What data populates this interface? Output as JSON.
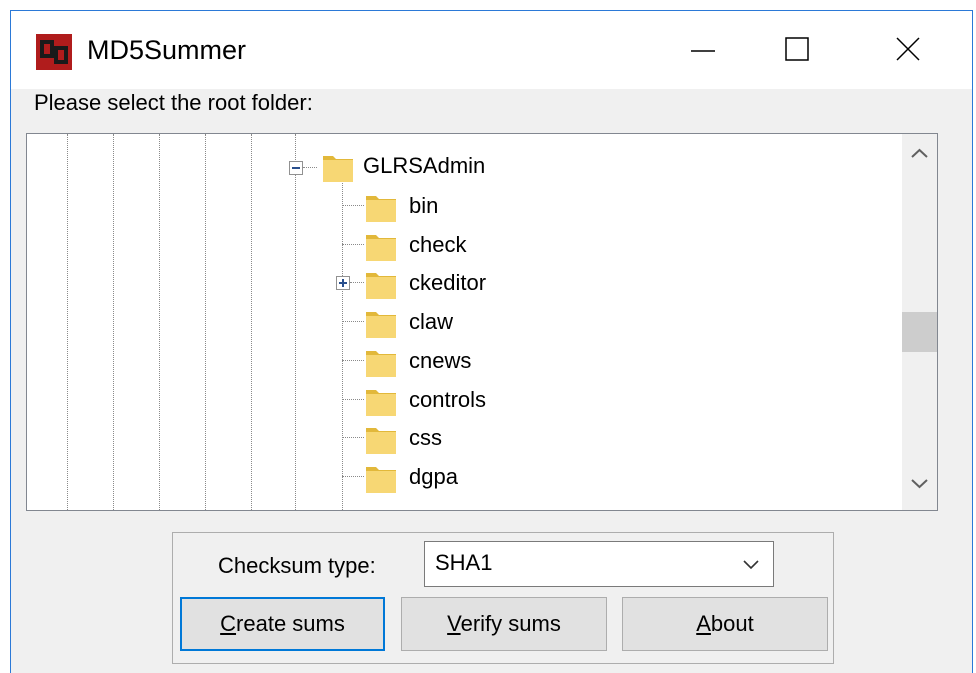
{
  "window": {
    "title": "MD5Summer",
    "icon": "md5summer-app-icon",
    "controls": [
      "minimize-icon",
      "maximize-icon",
      "close-icon"
    ]
  },
  "prompt": "Please select the root folder:",
  "tree": {
    "parent": {
      "label": "GLRSAdmin",
      "state": "expanded"
    },
    "children": [
      {
        "label": "bin",
        "expandable": false
      },
      {
        "label": "check",
        "expandable": false
      },
      {
        "label": "ckeditor",
        "expandable": true
      },
      {
        "label": "claw",
        "expandable": false
      },
      {
        "label": "cnews",
        "expandable": false
      },
      {
        "label": "controls",
        "expandable": false
      },
      {
        "label": "css",
        "expandable": false
      },
      {
        "label": "dgpa",
        "expandable": false
      }
    ],
    "scroll_position": 0.47
  },
  "checksum": {
    "label_prefix": "Checksum type:",
    "selected": "SHA1"
  },
  "buttons": {
    "create": {
      "mnemonic": "C",
      "rest": "reate sums"
    },
    "verify": {
      "mnemonic": "V",
      "rest": "erify sums"
    },
    "about": {
      "mnemonic": "A",
      "rest": "bout"
    }
  },
  "colors": {
    "accent": "#0078d7",
    "folder": "#f7d774",
    "folder_dark": "#e2b83a"
  }
}
